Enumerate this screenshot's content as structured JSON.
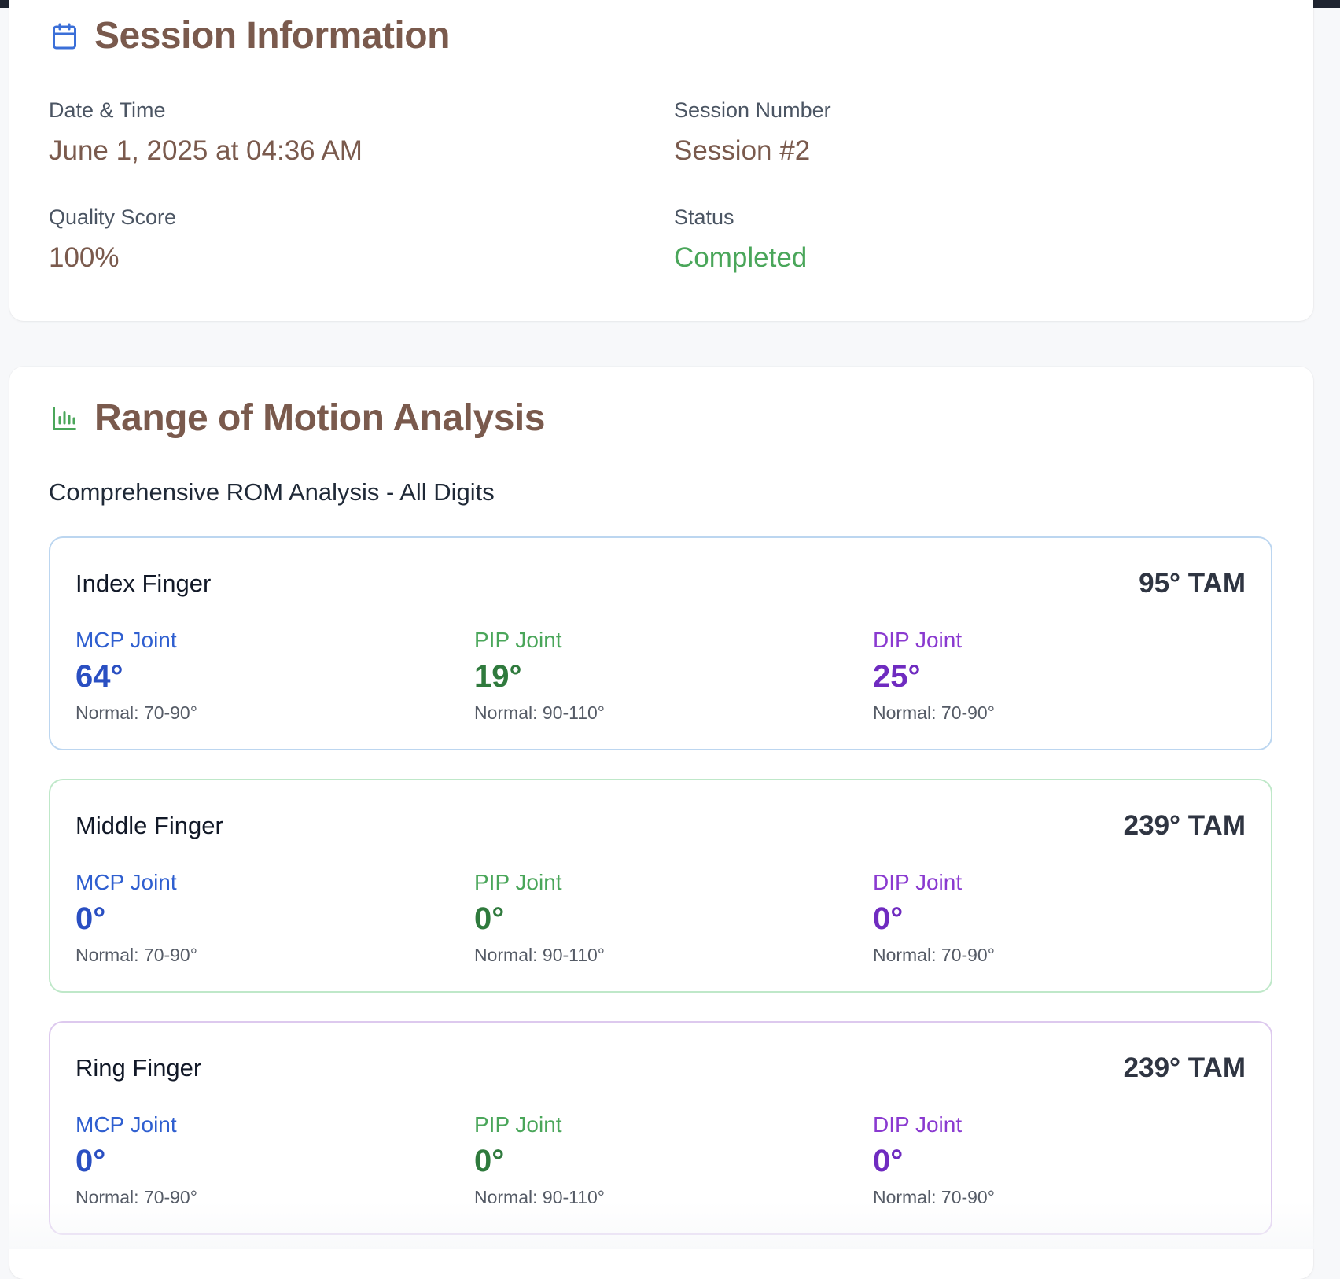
{
  "session": {
    "title": "Session Information",
    "icon": "calendar-icon",
    "fields": {
      "date_label": "Date & Time",
      "date_value": "June 1, 2025 at 04:36 AM",
      "session_number_label": "Session Number",
      "session_number_value": "Session #2",
      "quality_label": "Quality Score",
      "quality_value": "100%",
      "status_label": "Status",
      "status_value": "Completed"
    }
  },
  "rom": {
    "title": "Range of Motion Analysis",
    "icon": "bar-chart-icon",
    "subtitle": "Comprehensive ROM Analysis - All Digits",
    "fingers": [
      {
        "name": "Index Finger",
        "tam": "95° TAM",
        "mcp": {
          "label": "MCP Joint",
          "value": "64°",
          "normal": "Normal: 70-90°"
        },
        "pip": {
          "label": "PIP Joint",
          "value": "19°",
          "normal": "Normal: 90-110°"
        },
        "dip": {
          "label": "DIP Joint",
          "value": "25°",
          "normal": "Normal: 70-90°"
        }
      },
      {
        "name": "Middle Finger",
        "tam": "239° TAM",
        "mcp": {
          "label": "MCP Joint",
          "value": "0°",
          "normal": "Normal: 70-90°"
        },
        "pip": {
          "label": "PIP Joint",
          "value": "0°",
          "normal": "Normal: 90-110°"
        },
        "dip": {
          "label": "DIP Joint",
          "value": "0°",
          "normal": "Normal: 70-90°"
        }
      },
      {
        "name": "Ring Finger",
        "tam": "239° TAM",
        "mcp": {
          "label": "MCP Joint",
          "value": "0°",
          "normal": "Normal: 70-90°"
        },
        "pip": {
          "label": "PIP Joint",
          "value": "0°",
          "normal": "Normal: 90-110°"
        },
        "dip": {
          "label": "DIP Joint",
          "value": "0°",
          "normal": "Normal: 70-90°"
        }
      }
    ]
  },
  "colors": {
    "heading": "#7a5a4d",
    "mcp": "#2a4fc2",
    "pip": "#2f7a3d",
    "dip": "#6f2bc0",
    "status": "#4aa65a"
  }
}
